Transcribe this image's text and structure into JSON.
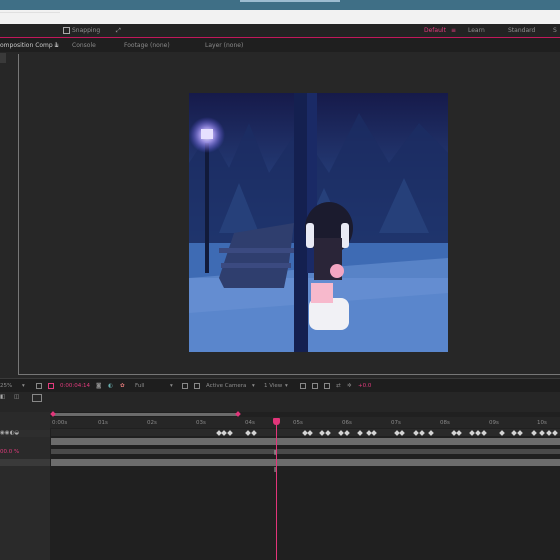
{
  "toolbar": {
    "snapping_label": "Snapping",
    "workspaces": [
      "Default",
      "Learn",
      "Standard"
    ],
    "active_workspace": "Default",
    "accent": "#e23b7d"
  },
  "panel_tabs": {
    "composition": "omposition Comp 1",
    "console": "Console",
    "footage": "Footage (none)",
    "layer": "Layer (none)"
  },
  "viewer_bar": {
    "zoom": "25%",
    "timecode": "0:00:04:14",
    "resolution": "Full",
    "camera": "Active Camera",
    "views": "1 View",
    "exposure": "+0.0"
  },
  "timeline": {
    "ticks": [
      "0:00s",
      "01s",
      "02s",
      "03s",
      "04s",
      "05s",
      "06s",
      "07s",
      "08s",
      "09s",
      "10s"
    ],
    "left_value": "00.0 %",
    "current_time_seconds": 4.6
  },
  "icons": [
    "snapping-checkbox-icon",
    "camera-icon",
    "color-wheel-icon",
    "grid-icon",
    "keyframe-icon"
  ]
}
